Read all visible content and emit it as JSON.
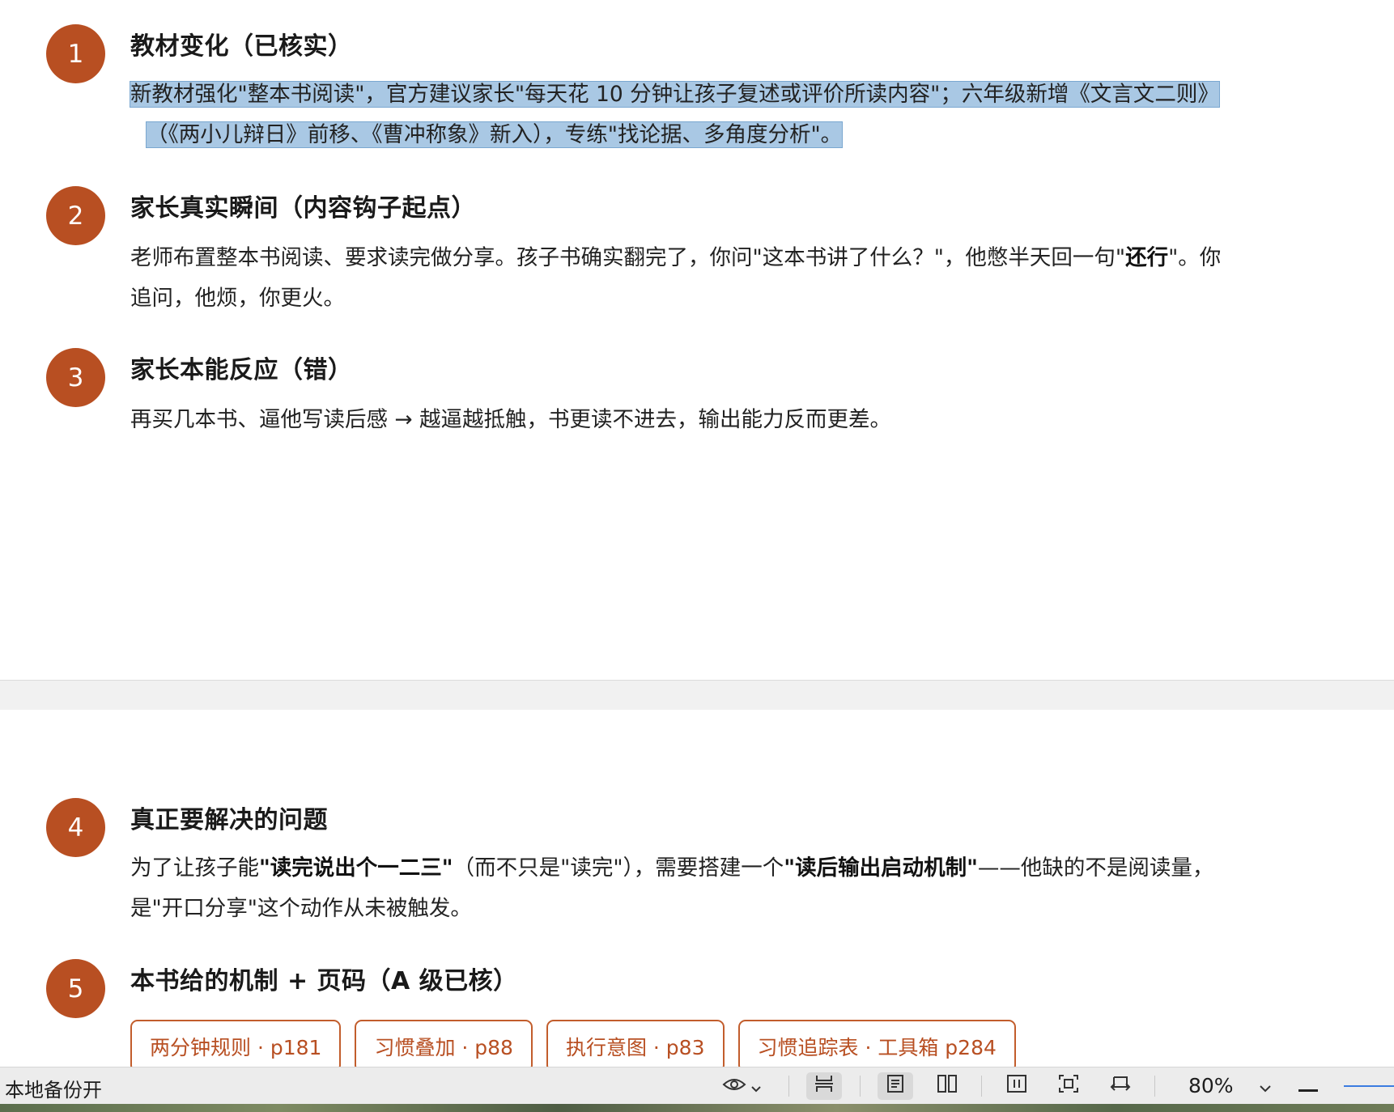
{
  "steps": [
    {
      "number": "1",
      "title": "教材变化（已核实）",
      "lines": [
        "新教材强化\"整本书阅读\"，官方建议家长\"每天花 10 分钟让孩子复述或评价所读内容\"；六年级新增《文言文二则》",
        "（《两小儿辩日》前移、《曹冲称象》新入），专练\"找论据、多角度分析\"。"
      ]
    },
    {
      "number": "2",
      "title": "家长真实瞬间（内容钩子起点）",
      "line1_pre": "老师布置整本书阅读、要求读完做分享。孩子书确实翻完了，你问\"这本书讲了什么？\"，他憋半天回一句\"",
      "line1_bold": "还行",
      "line1_post": "\"。你",
      "line2": "追问，他烦，你更火。"
    },
    {
      "number": "3",
      "title": "家长本能反应（错）",
      "line1": "再买几本书、逼他写读后感 → 越逼越抵触，书更读不进去，输出能力反而更差。"
    },
    {
      "number": "4",
      "title": "真正要解决的问题",
      "line1_a": "为了让孩子能",
      "line1_b": "\"读完说出个一二三\"",
      "line1_c": "（而不只是\"读完\"），需要搭建一个",
      "line1_d": "\"读后输出启动机制\"",
      "line1_e": "——他缺的不是阅读量，",
      "line2": "是\"开口分享\"这个动作从未被触发。"
    },
    {
      "number": "5",
      "title": "本书给的机制 + 页码（A 级已核）",
      "chips": [
        "两分钟规则 · p181",
        "习惯叠加 · p88",
        "执行意图 · p83",
        "习惯追踪表 · 工具箱 p284"
      ]
    }
  ],
  "statusbar": {
    "backup_label": "本地备份开",
    "zoom": "80%"
  },
  "colors": {
    "accent": "#b84f22",
    "selection": "#a9c8e4"
  }
}
